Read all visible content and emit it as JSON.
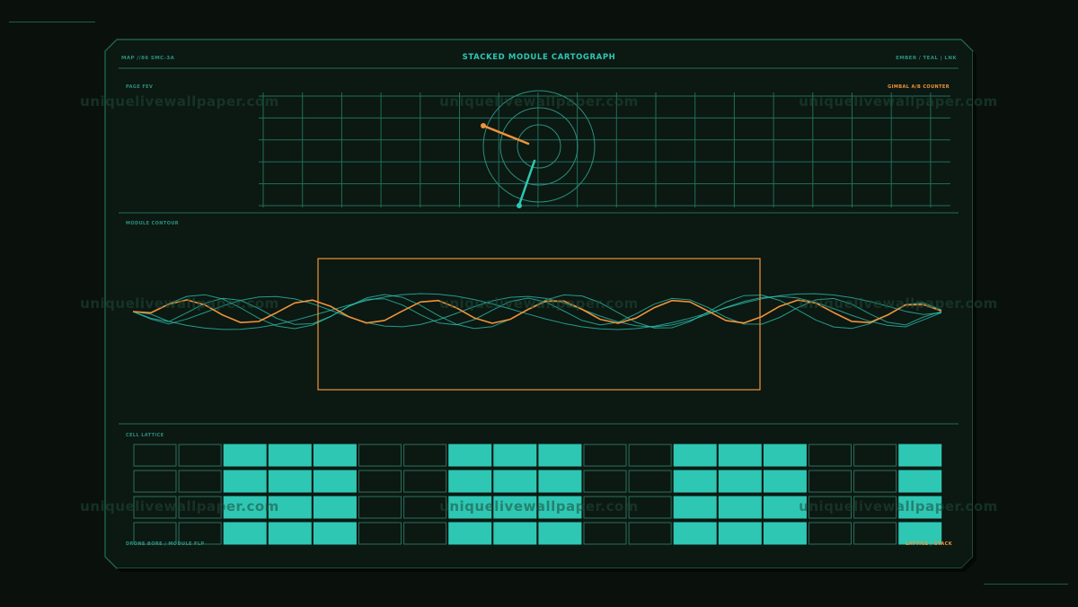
{
  "header": {
    "left_label": "MAP //86 SMC-3A",
    "title": "STACKED MODULE CARTOGRAPH",
    "right_label": "EMBER / TEAL | LNK"
  },
  "panels": {
    "top_label": "PAGE FEV",
    "top_right_label": "GIMBAL A/B COUNTER",
    "middle_label": "MODULE CONTOUR",
    "bottom_label": "CELL LATTICE",
    "footer_left": "DRONE BORE / MODULE FLP",
    "footer_right": "LATTICE / STACK"
  },
  "watermark": "uniquelivewallpaper.com",
  "grid": {
    "columns": 18,
    "rows": 4,
    "filled_columns": [
      2,
      3,
      4,
      7,
      8,
      9,
      12,
      13,
      14,
      17
    ]
  },
  "colors": {
    "background": "#0a110d",
    "panel": "#0c1812",
    "teal": "#2ec7b4",
    "teal_dim": "#1f6f5c",
    "ember": "#f0933a",
    "line": "#2a8f7d"
  }
}
